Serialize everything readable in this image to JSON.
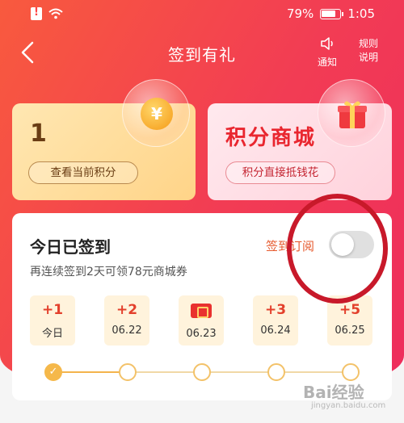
{
  "status_bar": {
    "battery": "79%",
    "time": "1:05"
  },
  "nav": {
    "title": "签到有礼",
    "notify_label": "通知",
    "rules_label_1": "规则",
    "rules_label_2": "说明"
  },
  "points_card": {
    "value": "1",
    "button_label": "查看当前积分",
    "coin_symbol": "¥"
  },
  "mall_card": {
    "title": "积分商城",
    "button_label": "积分直接抵钱花"
  },
  "checkin": {
    "title": "今日已签到",
    "subtitle": "再连续签到2天可领78元商城券",
    "subscribe_label": "签到订阅",
    "subscribe_on": false,
    "days": [
      {
        "reward": "+1",
        "date": "今日"
      },
      {
        "reward": "+2",
        "date": "06.22"
      },
      {
        "reward": "",
        "date": "06.23",
        "icon": "coupon-icon"
      },
      {
        "reward": "+3",
        "date": "06.24"
      },
      {
        "reward": "+5",
        "date": "06.25"
      }
    ],
    "done_count": 1
  },
  "watermark": {
    "brand": "Bai",
    "brand_cn": "经验",
    "url": "jingyan.baidu.com"
  },
  "colors": {
    "accent": "#f23c54",
    "gold": "#f5b84a",
    "reward_red": "#e3402c"
  }
}
